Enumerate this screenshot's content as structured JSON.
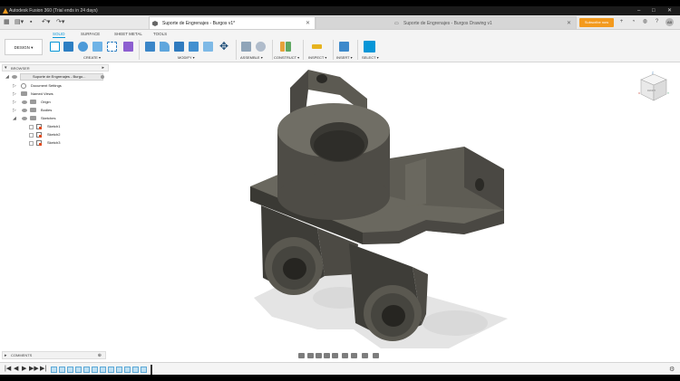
{
  "window": {
    "title": "Autodesk Fusion 360 (Trial ends in 24 days)",
    "controls": [
      "–",
      "□",
      "✕"
    ]
  },
  "quick_access": {
    "grid_icon": "grid-icon",
    "file_icon": "file-icon",
    "save_icon": "save-icon",
    "undo_icon": "undo-icon",
    "redo_icon": "redo-icon"
  },
  "tabs": [
    {
      "title": "Suporte de Engrenajes - Burgos v1*",
      "active": true,
      "close": "✕"
    },
    {
      "title": "Suporte de Engrenajes - Burgos Drawing v1",
      "active": false,
      "close": "✕"
    }
  ],
  "header_right": {
    "subscribe_label": "Subscribe now",
    "avatar_initials": "AB",
    "icons": [
      "plus-icon",
      "job-status-icon",
      "notifications-icon",
      "help-icon",
      "avatar"
    ]
  },
  "ribbon": {
    "workspace_label": "DESIGN",
    "workspace_tabs": [
      "SOLID",
      "SURFACE",
      "SHEET METAL",
      "TOOLS"
    ],
    "active_tab": "SOLID",
    "groups": [
      "CREATE",
      "MODIFY",
      "ASSEMBLE",
      "CONSTRUCT",
      "INSPECT",
      "INSERT",
      "SELECT"
    ],
    "accent_color": "#0696d7"
  },
  "browser": {
    "header": "BROWSER",
    "root": "Suporte de Engrenajes - Burgo...",
    "items": [
      {
        "label": "Document Settings",
        "icon": "gear-icon"
      },
      {
        "label": "Named Views",
        "icon": "folder-icon"
      },
      {
        "label": "Origin",
        "icon": "folder-icon"
      },
      {
        "label": "Bodies",
        "icon": "folder-icon"
      },
      {
        "label": "Sketches",
        "icon": "folder-icon"
      }
    ],
    "sketches": [
      "Sketch1",
      "Sketch2",
      "Sketch3"
    ]
  },
  "comments": {
    "label": "COMMENTS"
  },
  "viewcube": {
    "face_label": "FRONT",
    "axis_labels": [
      "Z",
      "X",
      "Y"
    ]
  },
  "timeline": {
    "controls": [
      "|◀",
      "◀",
      "▶",
      "▶▶",
      "▶|"
    ],
    "feature_count": 12
  }
}
